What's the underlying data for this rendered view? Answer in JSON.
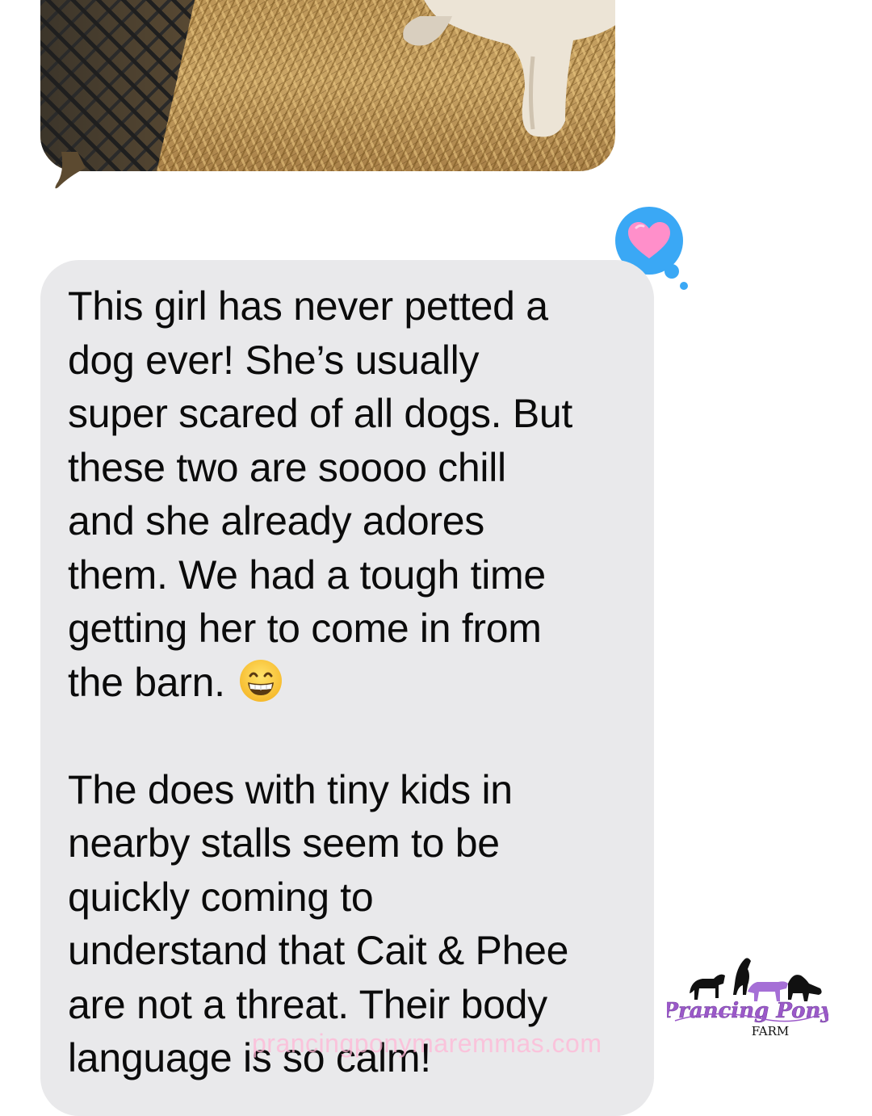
{
  "message": {
    "paragraph1": [
      "This girl has never petted a",
      "dog ever! She’s usually",
      "super scared of all dogs. But",
      "these two are soooo chill",
      "and she already adores",
      "them. We had a tough time",
      "getting her to come in from",
      "the barn."
    ],
    "paragraph2": [
      "The does with tiny kids in",
      "nearby stalls seem to be",
      "quickly coming to",
      "understand that Cait & Phee",
      "are not a threat. Their body",
      "language is so calm!"
    ],
    "emoji": "grinning-face-with-smiling-eyes"
  },
  "reaction": {
    "type": "heart",
    "color": "#ff7fc0",
    "bubble_color": "#3aa8f5"
  },
  "watermark": {
    "text": "prancingponymaremmas.com"
  },
  "logo": {
    "line1": "Prancing Pony",
    "line2": "FARM",
    "brand_color": "#9b59c9"
  },
  "colors": {
    "bubble_gray": "#e9e9eb",
    "text": "#0b0b0b"
  }
}
